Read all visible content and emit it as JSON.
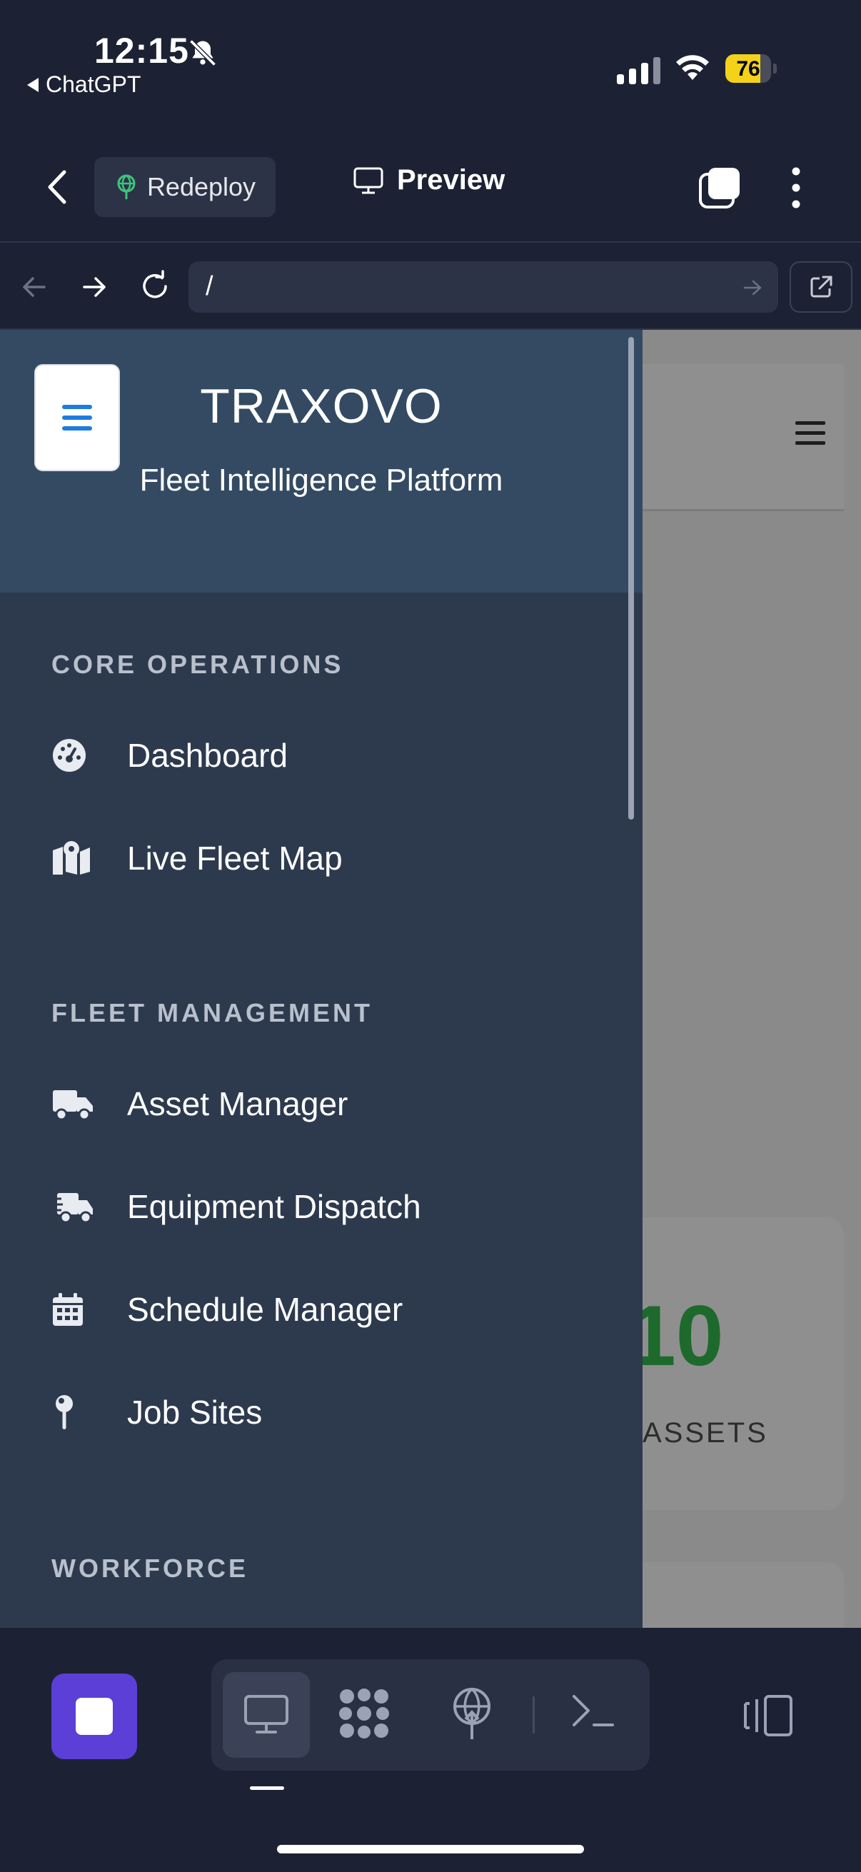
{
  "status_bar": {
    "time": "12:15",
    "back_app": "ChatGPT",
    "battery": "76",
    "battery_level": 0.76
  },
  "header": {
    "redeploy_label": "Redeploy",
    "preview_label": "Preview"
  },
  "url_bar": {
    "value": "/"
  },
  "sidebar": {
    "brand": "TRAXOVO",
    "tagline": "Fleet Intelligence Platform",
    "sections": [
      {
        "title": "CORE OPERATIONS",
        "items": [
          {
            "label": "Dashboard",
            "icon": "gauge-icon"
          },
          {
            "label": "Live Fleet Map",
            "icon": "map-icon"
          }
        ]
      },
      {
        "title": "FLEET MANAGEMENT",
        "items": [
          {
            "label": "Asset Manager",
            "icon": "truck-icon"
          },
          {
            "label": "Equipment Dispatch",
            "icon": "fast-truck-icon"
          },
          {
            "label": "Schedule Manager",
            "icon": "calendar-icon"
          },
          {
            "label": "Job Sites",
            "icon": "pin-icon"
          }
        ]
      },
      {
        "title": "WORKFORCE",
        "items": []
      }
    ]
  },
  "background": {
    "asset_count": "10",
    "asset_label": "ASSETS"
  },
  "colors": {
    "accent_purple": "#5b3fd6",
    "sidebar_bg": "#2d3a4e",
    "sidebar_header_bg": "#334a62",
    "hamburger_blue": "#1e7be0",
    "asset_green": "#1d6a2c",
    "battery_yellow": "#f4d21a"
  }
}
